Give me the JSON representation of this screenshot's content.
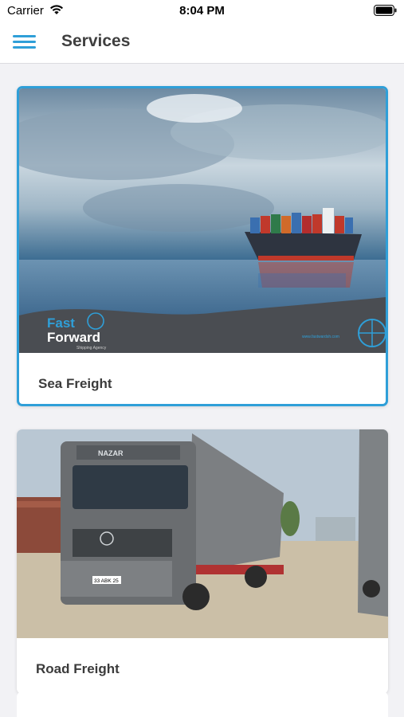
{
  "status_bar": {
    "carrier": "Carrier",
    "time": "8:04 PM"
  },
  "header": {
    "title": "Services",
    "menu_icon": "hamburger-menu-icon"
  },
  "services": [
    {
      "label": "Sea Freight",
      "image": "container-ship-photo",
      "image_logo": {
        "line1": "Fast",
        "line2": "Forward",
        "tagline": "Shipping Agency",
        "url": "www.fastwardsh.com"
      }
    },
    {
      "label": "Road Freight",
      "image": "truck-photo",
      "image_text": {
        "windshield": "NAZAR",
        "plate": "33 ABK 25"
      }
    }
  ],
  "colors": {
    "accent": "#2f9fd8",
    "title_text": "#3f3f3f",
    "background": "#f2f2f5"
  }
}
